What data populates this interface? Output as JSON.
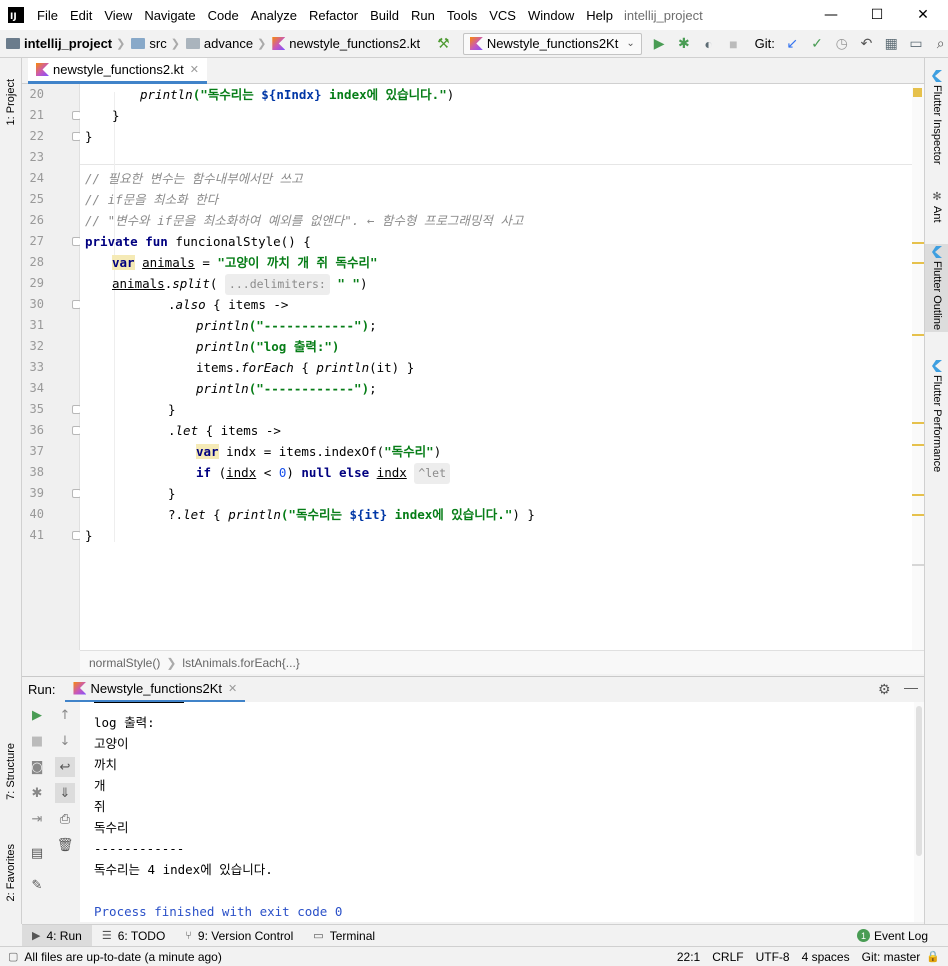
{
  "titlebar": {
    "logo_text": "IJ",
    "menu": [
      "File",
      "Edit",
      "View",
      "Navigate",
      "Code",
      "Analyze",
      "Refactor",
      "Build",
      "Run",
      "Tools",
      "VCS",
      "Window",
      "Help"
    ],
    "title": "intellij_project",
    "minimize": "—",
    "maximize": "☐",
    "close": "✕"
  },
  "navbar": {
    "project": "intellij_project",
    "src": "src",
    "package": "advance",
    "file": "newstyle_functions2.kt",
    "run_config": "Newstyle_functions2Kt",
    "git_label": "Git:"
  },
  "left_stripe": {
    "project": "1: Project",
    "structure": "7: Structure",
    "favorites": "2: Favorites"
  },
  "right_stripe": {
    "flutter_inspector": "Flutter Inspector",
    "ant": "Ant",
    "flutter_outline": "Flutter Outline",
    "flutter_performance": "Flutter Performance"
  },
  "editor_tab": {
    "label": "newstyle_functions2.kt"
  },
  "editor": {
    "line_numbers": [
      "20",
      "21",
      "22",
      "23",
      "24",
      "25",
      "26",
      "27",
      "28",
      "29",
      "30",
      "31",
      "32",
      "33",
      "34",
      "35",
      "36",
      "37",
      "38",
      "39",
      "40",
      "41"
    ],
    "l20_fn": "println",
    "l20_s1": "(\"독수리는 ",
    "l20_tmpl": "${nIndx}",
    "l20_s2": " index에 있습니다.\"",
    "l20_end": ")",
    "l21": "}",
    "l22": "}",
    "l24": "// 필요한 변수는 함수내부에서만 쓰고",
    "l25": "// if문을 최소화 한다",
    "l26": "// \"변수와 if문을 최소화하여 예외를 없앤다\". ← 함수형 프로그래밍적 사고",
    "l27_kw": "private fun",
    "l27_rest": " funcionalStyle() {",
    "l28_kw": "var",
    "l28_name": "animals",
    "l28_eq": " = ",
    "l28_str": "\"고양이 까치 개 쥐 독수리\"",
    "l29_name": "animals",
    "l29_dot": ".",
    "l29_fn": "split",
    "l29_open": "(",
    "l29_hint": "...delimiters:",
    "l29_str": " \" \"",
    "l29_close": ")",
    "l30_dot": ".",
    "l30_fn": "also",
    "l30_rest": " { items ->",
    "l31_fn": "println",
    "l31_s": "(\"------------\")",
    "l31_e": ";",
    "l32_fn": "println",
    "l32_s": "(\"log 출력:\")",
    "l33_a": "items.",
    "l33_fn": "forEach",
    "l33_b": " { ",
    "l33_fn2": "println",
    "l33_c": "(it) }",
    "l34_fn": "println",
    "l34_s": "(\"------------\")",
    "l34_e": ";",
    "l35": "}",
    "l36_dot": ".",
    "l36_fn": "let",
    "l36_rest": " { items ->",
    "l37_kw": "var",
    "l37_rest": " indx = items.indexOf(",
    "l37_str": "\"독수리\"",
    "l37_end": ")",
    "l38_kw": "if",
    "l38_a": " (",
    "l38_v": "indx",
    "l38_b": " < ",
    "l38_num": "0",
    "l38_c": ") ",
    "l38_kw2": "null else",
    "l38_d": " ",
    "l38_v2": "indx",
    "l38_hint": "^let",
    "l39": "}",
    "l40_a": "?.",
    "l40_fn": "let",
    "l40_b": " { ",
    "l40_fn2": "println",
    "l40_s1": "(\"독수리는 ",
    "l40_tmpl": "${it}",
    "l40_s2": " index에 있습니다.\"",
    "l40_end": ") }",
    "l41": "}"
  },
  "editor_breadcrumbs": [
    "normalStyle()",
    "lstAnimals.forEach{...}"
  ],
  "run_panel": {
    "label": "Run:",
    "tab": "Newstyle_functions2Kt",
    "output": [
      "log 출력:",
      "고양이",
      "까치",
      "개",
      "쥐",
      "독수리",
      "------------",
      "독수리는 4 index에 있습니다.",
      "",
      "Process finished with exit code 0"
    ]
  },
  "bottom_tabs": {
    "run": "4: Run",
    "todo": "6: TODO",
    "vcs": "9: Version Control",
    "terminal": "Terminal",
    "event_log": "Event Log",
    "event_count": "1"
  },
  "statusbar": {
    "message": "All files are up-to-date (a minute ago)",
    "position": "22:1",
    "line_sep": "CRLF",
    "encoding": "UTF-8",
    "indent": "4 spaces",
    "git_branch": "Git: master"
  },
  "colors": {
    "accent": "#4083c9",
    "keyword": "#000080",
    "string": "#067d17",
    "comment": "#8c8c8c",
    "run_green": "#499c54"
  }
}
